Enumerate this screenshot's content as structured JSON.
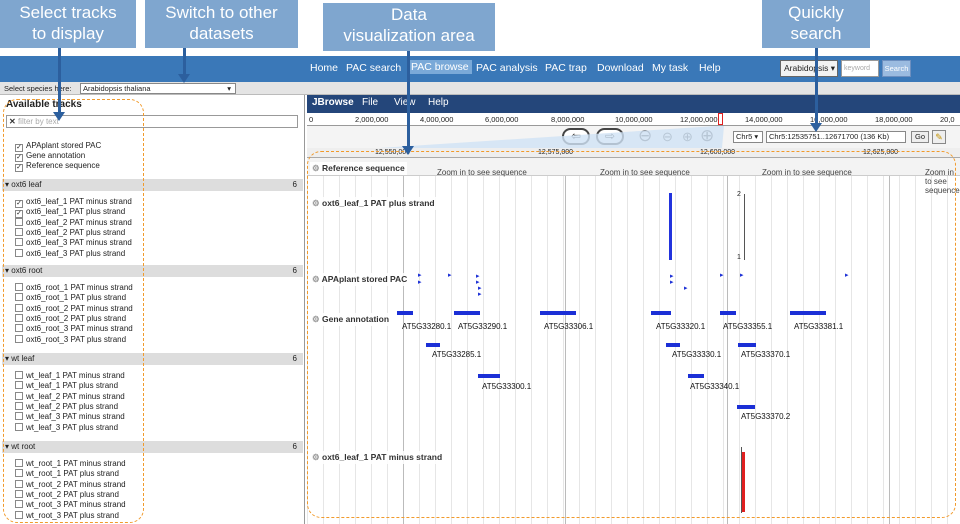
{
  "callouts": {
    "select_tracks": "Select tracks\nto display",
    "switch_datasets": "Switch to other\ndatasets",
    "data_viz": "Data\nvisualization area",
    "quick_search": "Quickly\nsearch"
  },
  "nav": {
    "home": "Home",
    "pac_search": "PAC search",
    "pac_browse": "PAC browse",
    "pac_analysis": "PAC analysis",
    "pac_trap": "PAC trap",
    "download": "Download",
    "my_task": "My task",
    "help": "Help",
    "species_select": "Arabidopsis ▾",
    "keyword_placeholder": "keyword",
    "search_btn": "Search"
  },
  "species": {
    "label": "Select species here:",
    "value": "Arabidopsis thaliana"
  },
  "sidebar": {
    "title": "Available tracks",
    "filter_placeholder": "filter by text",
    "top_tracks": [
      "APAplant stored PAC",
      "Gene annotation",
      "Reference sequence"
    ],
    "sections": [
      {
        "name": "oxt6 leaf",
        "count": "6",
        "tracks": [
          "oxt6_leaf_1 PAT minus strand",
          "oxt6_leaf_1 PAT plus strand",
          "oxt6_leaf_2 PAT minus strand",
          "oxt6_leaf_2 PAT plus strand",
          "oxt6_leaf_3 PAT minus strand",
          "oxt6_leaf_3 PAT plus strand"
        ],
        "checked": [
          true,
          true,
          false,
          false,
          false,
          false
        ]
      },
      {
        "name": "oxt6 root",
        "count": "6",
        "tracks": [
          "oxt6_root_1 PAT minus strand",
          "oxt6_root_1 PAT plus strand",
          "oxt6_root_2 PAT minus strand",
          "oxt6_root_2 PAT plus strand",
          "oxt6_root_3 PAT minus strand",
          "oxt6_root_3 PAT plus strand"
        ],
        "checked": [
          false,
          false,
          false,
          false,
          false,
          false
        ]
      },
      {
        "name": "wt leaf",
        "count": "6",
        "tracks": [
          "wt_leaf_1 PAT minus strand",
          "wt_leaf_1 PAT plus strand",
          "wt_leaf_2 PAT minus strand",
          "wt_leaf_2 PAT plus strand",
          "wt_leaf_3 PAT minus strand",
          "wt_leaf_3 PAT plus strand"
        ],
        "checked": [
          false,
          false,
          false,
          false,
          false,
          false
        ]
      },
      {
        "name": "wt root",
        "count": "6",
        "tracks": [
          "wt_root_1 PAT minus strand",
          "wt_root_1 PAT plus strand",
          "wt_root_2 PAT minus strand",
          "wt_root_2 PAT plus strand",
          "wt_root_3 PAT minus strand",
          "wt_root_3 PAT plus strand"
        ],
        "checked": [
          false,
          false,
          false,
          false,
          false,
          false
        ]
      }
    ]
  },
  "jbrowse": {
    "brand": "JBrowse",
    "file": "File",
    "view": "View",
    "help": "Help",
    "ruler_ticks": [
      "0",
      "2,000,000",
      "4,000,000",
      "6,000,000",
      "8,000,000",
      "10,000,000",
      "12,000,000",
      "14,000,000",
      "16,000,000",
      "18,000,000",
      "20,0"
    ],
    "chrom": "Chr5 ▾",
    "location": "Chr5:12535751..12671700 (136 Kb)",
    "go": "Go",
    "detail_ticks": [
      "12,550,000",
      "12,575,000",
      "12,600,000",
      "12,625,000"
    ]
  },
  "tracks": {
    "reference": "Reference sequence",
    "zoom_msg": "Zoom in to see sequence",
    "plus": "oxt6_leaf_1 PAT plus strand",
    "stored": "APAplant stored PAC",
    "annotation": "Gene annotation",
    "minus": "oxt6_leaf_1 PAT minus strand",
    "scale_top": "2",
    "scale_bot": "1",
    "genes": [
      "AT5G33280.1",
      "AT5G33290.1",
      "AT5G33306.1",
      "AT5G33320.1",
      "AT5G33355.1",
      "AT5G33381.1",
      "AT5G33285.1",
      "AT5G33330.1",
      "AT5G33370.1",
      "AT5G33300.1",
      "AT5G33340.1",
      "AT5G33370.2"
    ]
  },
  "colors": {
    "nav": "#3a78b8",
    "jbrowse_bar": "#24467a",
    "gene": "#1b2fd6",
    "minus_signal": "#e02020",
    "callout": "#7fa6cf",
    "dashed": "#f19a2b"
  }
}
